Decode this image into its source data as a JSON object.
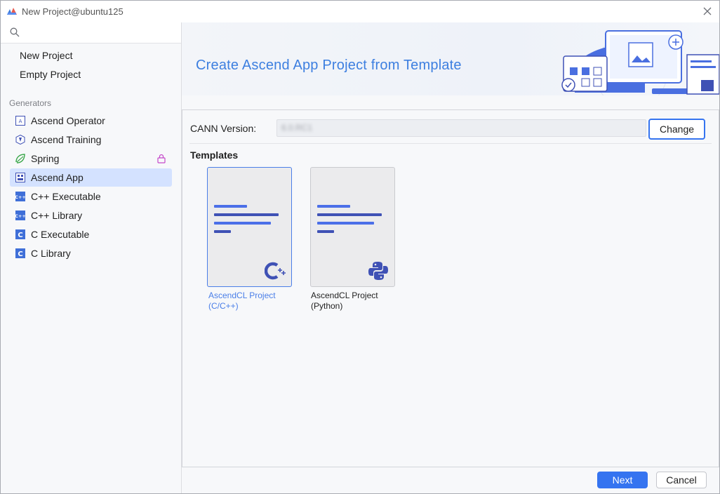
{
  "window": {
    "title": "New Project@ubuntu125"
  },
  "sidebar": {
    "search": {
      "value": "",
      "placeholder": ""
    },
    "links": [
      {
        "label": "New Project"
      },
      {
        "label": "Empty Project"
      }
    ],
    "section_label": "Generators",
    "items": [
      {
        "label": "Ascend Operator",
        "icon": "ascend-operator-icon"
      },
      {
        "label": "Ascend Training",
        "icon": "ascend-training-icon"
      },
      {
        "label": "Spring",
        "icon": "spring-icon",
        "locked": true
      },
      {
        "label": "Ascend App",
        "icon": "ascend-app-icon",
        "selected": true
      },
      {
        "label": "C++ Executable",
        "icon": "cpp-icon"
      },
      {
        "label": "C++ Library",
        "icon": "cpp-icon"
      },
      {
        "label": "C Executable",
        "icon": "c-icon"
      },
      {
        "label": "C Library",
        "icon": "c-icon"
      }
    ]
  },
  "main": {
    "banner_title": "Create Ascend App Project from Template",
    "cann_label": "CANN Version:",
    "cann_value": "6.0.RC1",
    "change_label": "Change",
    "templates_label": "Templates",
    "templates": [
      {
        "label_line1": "AscendCL Project",
        "label_line2": "(C/C++)",
        "icon": "cpp-logo-icon",
        "selected": true
      },
      {
        "label_line1": "AscendCL Project",
        "label_line2": "(Python)",
        "icon": "python-logo-icon",
        "selected": false
      }
    ]
  },
  "footer": {
    "next_label": "Next",
    "cancel_label": "Cancel"
  },
  "colors": {
    "accent": "#3574f0",
    "selection_bg": "#d4e2ff",
    "banner_title": "#3d7fe0"
  }
}
